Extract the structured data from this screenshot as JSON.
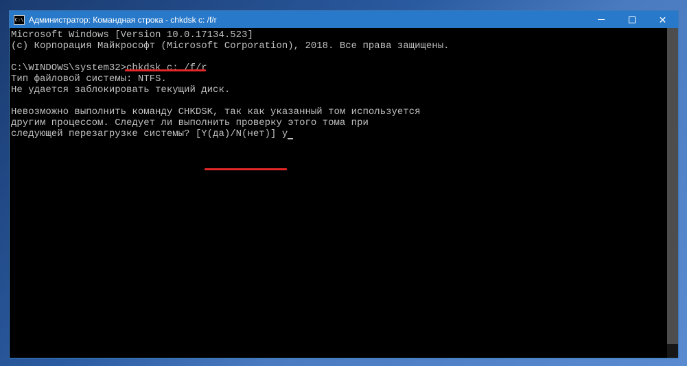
{
  "titlebar": {
    "icon_label": "C:\\",
    "text": "Администратор: Командная строка - chkdsk  c: /f/r"
  },
  "terminal": {
    "line1": "Microsoft Windows [Version 10.0.17134.523]",
    "line2": "(c) Корпорация Майкрософт (Microsoft Corporation), 2018. Все права защищены.",
    "line3": "",
    "prompt": "C:\\WINDOWS\\system32>",
    "command": "chkdsk c: /f/r",
    "line5": "Тип файловой системы: NTFS.",
    "line6": "Не удается заблокировать текущий диск.",
    "line7": "",
    "line8": "Невозможно выполнить команду CHKDSK, так как указанный том используется",
    "line9": "другим процессом. Следует ли выполнить проверку этого тома при",
    "line10": "следующей перезагрузке системы? [Y(да)/N(нет)] ",
    "input": "y"
  }
}
